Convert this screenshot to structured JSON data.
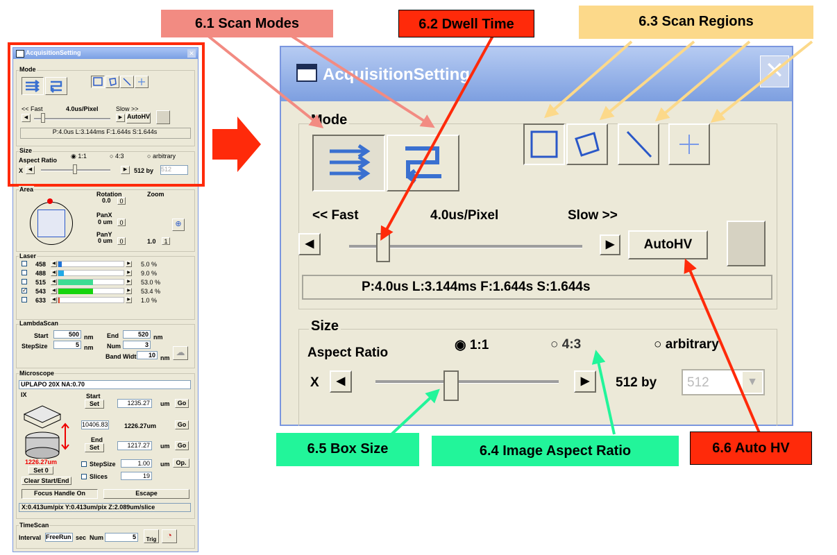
{
  "callouts": {
    "scan_modes": "6.1 Scan Modes",
    "dwell_time": "6.2 Dwell Time",
    "scan_regions": "6.3 Scan Regions",
    "aspect_ratio": "6.4 Image Aspect Ratio",
    "box_size": "6.5 Box Size",
    "auto_hv": "6.6 Auto HV"
  },
  "colors": {
    "pink": "#f28b82",
    "red": "#ff2a0a",
    "gold": "#fcd98a",
    "green": "#22f59a"
  },
  "window": {
    "title": "AcquisitionSetting"
  },
  "mode": {
    "label": "Mode",
    "fast": "<< Fast",
    "rate": "4.0us/Pixel",
    "slow": "Slow >>",
    "autohv": "AutoHV",
    "status": "P:4.0us  L:3.144ms  F:1.644s  S:1.644s"
  },
  "size": {
    "label": "Size",
    "aspect_label": "Aspect Ratio",
    "r11": "1:1",
    "r43": "4:3",
    "arb": "arbitrary",
    "x": "X",
    "by": "512 by",
    "val": "512"
  },
  "area": {
    "label": "Area",
    "rotation": "Rotation",
    "rot_val": "0.0",
    "zoom": "Zoom",
    "panx": "PanX",
    "panx_val": "0 um",
    "pany": "PanY",
    "pany_val": "0 um",
    "zero": "0",
    "zoom_val": "1.0",
    "one": "1"
  },
  "laser": {
    "label": "Laser",
    "rows": [
      {
        "wl": "458",
        "pct": "5.0 %",
        "fill": 0.05,
        "color": "#1e72d8",
        "checked": false
      },
      {
        "wl": "488",
        "pct": "9.0 %",
        "fill": 0.09,
        "color": "#21a9e6",
        "checked": false
      },
      {
        "wl": "515",
        "pct": "53.0 %",
        "fill": 0.53,
        "color": "#3ddc92",
        "checked": false
      },
      {
        "wl": "543",
        "pct": "53.4 %",
        "fill": 0.534,
        "color": "#16d40d",
        "checked": true
      },
      {
        "wl": "633",
        "pct": "1.0 %",
        "fill": 0.01,
        "color": "#e04a2a",
        "checked": false
      }
    ]
  },
  "lambda": {
    "label": "LambdaScan",
    "start": "Start",
    "start_val": "500",
    "nm": "nm",
    "end": "End",
    "end_val": "520",
    "stepsize": "StepSize",
    "step_val": "5",
    "num": "Num",
    "num_val": "3",
    "bandwidth": "Band Width",
    "bw_val": "10"
  },
  "micro": {
    "label": "Microscope",
    "objective": "UPLAPO  20X NA:0.70",
    "ix": "IX",
    "start": "Start",
    "set": "Set",
    "start_val": "1235.27",
    "um": "um",
    "go": "Go",
    "pos_val": "10406.83",
    "mid_val": "1226.27um",
    "end": "End",
    "end_val": "1217.27",
    "red_val": "1226.27um",
    "set0": "Set 0",
    "stepsize": "StepSize",
    "step_val": "1.00",
    "op": "Op.",
    "slices": "Slices",
    "slices_val": "19",
    "clear": "Clear Start/End",
    "focus": "Focus Handle On",
    "escape": "Escape",
    "pixinfo": "X:0.413um/pix Y:0.413um/pix Z:2.089um/slice"
  },
  "time": {
    "label": "TimeScan",
    "interval": "Interval",
    "freerun": "FreeRun",
    "sec": "sec",
    "num": "Num",
    "num_val": "5",
    "trig": "Trig"
  }
}
